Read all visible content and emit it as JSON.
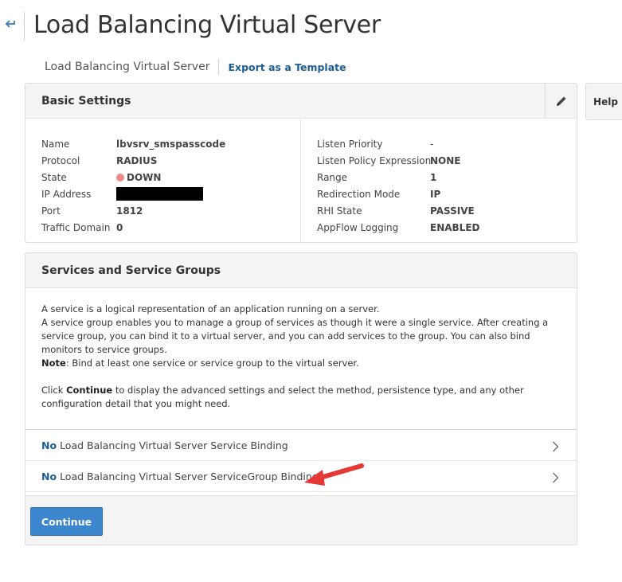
{
  "header": {
    "back_icon": "back-arrow-icon",
    "title": "Load Balancing Virtual Server"
  },
  "breadcrumb": {
    "current": "Load Balancing Virtual Server",
    "export_link": "Export as a Template"
  },
  "help": {
    "label": "Help"
  },
  "basic_settings": {
    "title": "Basic Settings",
    "edit_icon": "pencil-icon",
    "left": [
      {
        "label": "Name",
        "value": "lbvsrv_smspasscode"
      },
      {
        "label": "Protocol",
        "value": "RADIUS"
      },
      {
        "label": "State",
        "value": "DOWN"
      },
      {
        "label": "IP Address",
        "value": ""
      },
      {
        "label": "Port",
        "value": "1812"
      },
      {
        "label": "Traffic Domain",
        "value": "0"
      }
    ],
    "right": [
      {
        "label": "Listen Priority",
        "value": "-"
      },
      {
        "label": "Listen Policy Expression",
        "value": "NONE"
      },
      {
        "label": "Range",
        "value": "1"
      },
      {
        "label": "Redirection Mode",
        "value": "IP"
      },
      {
        "label": "RHI State",
        "value": "PASSIVE"
      },
      {
        "label": "AppFlow Logging",
        "value": "ENABLED"
      }
    ],
    "status_color": "#f08a8a"
  },
  "services": {
    "title": "Services and Service Groups",
    "desc_line1": "A service is a logical representation of an application running on a server.",
    "desc_line2": "A service group enables you to manage a group of services as though it were a single service. After creating a service group, you can bind it to a virtual server, and you can add services to the group. You can also bind monitors to service groups.",
    "note_label": "Note",
    "note_text": ": Bind at least one service or service group to the virtual server.",
    "click_prefix": "Click ",
    "click_bold": "Continue",
    "click_suffix": " to display the advanced settings and select the method, persistence type, and any other configuration detail that you might need.",
    "bindings": [
      {
        "prefix": "No",
        "label": "Load Balancing Virtual Server Service Binding"
      },
      {
        "prefix": "No",
        "label": "Load Balancing Virtual Server ServiceGroup Binding"
      }
    ],
    "continue_label": "Continue"
  },
  "colors": {
    "accent": "#1c5d94",
    "button": "#3b86cc",
    "annotation_arrow": "#e53935"
  }
}
